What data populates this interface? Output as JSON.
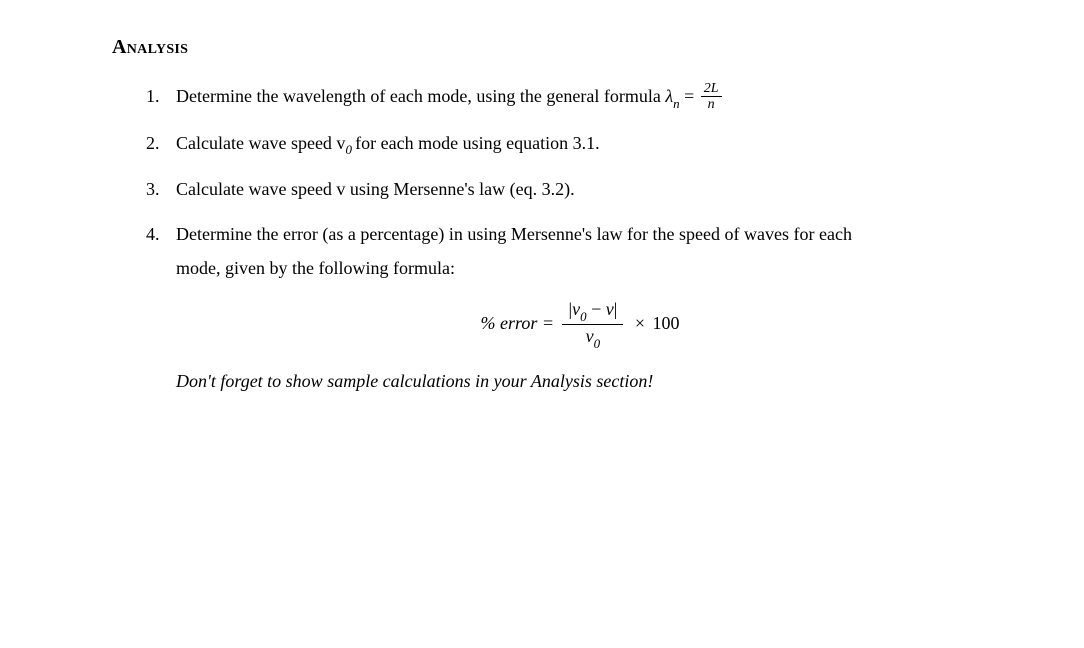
{
  "heading": "Analysis",
  "items": [
    {
      "num": "1.",
      "text_before": "Determine the wavelength of each mode, using the general formula ",
      "lambda": "λ",
      "lambda_sub": "n",
      "equals": " = ",
      "frac_top": "2L",
      "frac_bot": "n"
    },
    {
      "num": "2.",
      "text_before": "Calculate wave speed v",
      "v_sub": "0 ",
      "text_after": "for each mode using equation 3.1."
    },
    {
      "num": "3.",
      "text": "Calculate wave speed v using Mersenne's law (eq. 3.2)."
    },
    {
      "num": "4.",
      "line1": "Determine the error (as a percentage) in using Mersenne's law for the speed of waves for each",
      "line2": "mode, given by the following formula:",
      "formula": {
        "lhs": "% error = ",
        "abs_open": "|",
        "v0": "v",
        "v0_sub": "0",
        "minus": " − ",
        "v": "v",
        "abs_close": "|",
        "denom_v": "v",
        "denom_sub": "0",
        "times": " × ",
        "hundred": "100"
      },
      "reminder": "Don't forget to show sample calculations in your Analysis section!"
    }
  ]
}
